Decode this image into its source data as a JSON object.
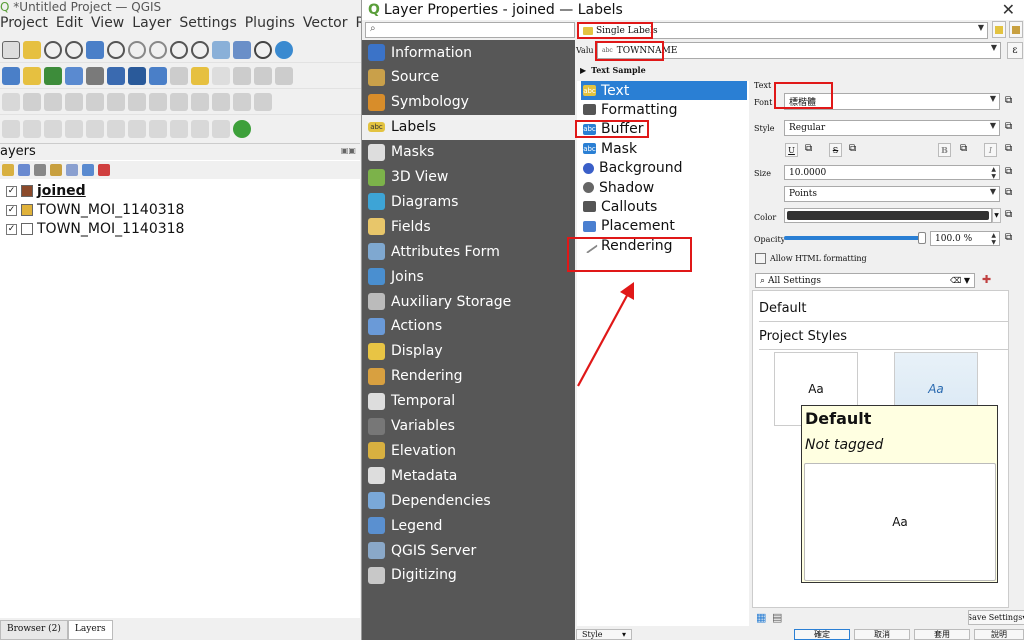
{
  "qgis": {
    "title": "*Untitled Project — QGIS",
    "menu": [
      "Project",
      "Edit",
      "View",
      "Layer",
      "Settings",
      "Plugins",
      "Vector",
      "Ra"
    ],
    "layers_panel": {
      "title": "ayers",
      "layers": [
        {
          "name": "joined",
          "color": "#8b4a2b",
          "checked": "✓",
          "bold": true
        },
        {
          "name": "TOWN_MOI_1140318",
          "color": "#e0b23a",
          "checked": "✓",
          "bold": false
        },
        {
          "name": "TOWN_MOI_1140318",
          "color": "#ffffff",
          "checked": "✓",
          "bold": false
        }
      ]
    },
    "bottom_tabs": [
      "Browser (2)",
      "Layers"
    ]
  },
  "dialog": {
    "title": "Layer Properties - joined — Labels",
    "nav": [
      {
        "label": "Information",
        "icon": "info-icon",
        "color": "#3b73c8"
      },
      {
        "label": "Source",
        "icon": "source-icon",
        "color": "#c9a04a"
      },
      {
        "label": "Symbology",
        "icon": "symbology-icon",
        "color": "#d88d2a"
      },
      {
        "label": "Labels",
        "icon": "labels-icon",
        "color": "#e3c340"
      },
      {
        "label": "Masks",
        "icon": "masks-icon",
        "color": "#dddddd"
      },
      {
        "label": "3D View",
        "icon": "3d-view-icon",
        "color": "#7cb24a"
      },
      {
        "label": "Diagrams",
        "icon": "diagrams-icon",
        "color": "#3da4d6"
      },
      {
        "label": "Fields",
        "icon": "fields-icon",
        "color": "#e8c66a"
      },
      {
        "label": "Attributes Form",
        "icon": "attributes-form-icon",
        "color": "#7fa8d0"
      },
      {
        "label": "Joins",
        "icon": "joins-icon",
        "color": "#4a8fd0"
      },
      {
        "label": "Auxiliary Storage",
        "icon": "auxiliary-storage-icon",
        "color": "#bbbbbb"
      },
      {
        "label": "Actions",
        "icon": "actions-icon",
        "color": "#6a9ad8"
      },
      {
        "label": "Display",
        "icon": "display-icon",
        "color": "#e8c444"
      },
      {
        "label": "Rendering",
        "icon": "rendering-icon",
        "color": "#d8a040"
      },
      {
        "label": "Temporal",
        "icon": "temporal-icon",
        "color": "#dddddd"
      },
      {
        "label": "Variables",
        "icon": "variables-icon",
        "color": "#777777"
      },
      {
        "label": "Elevation",
        "icon": "elevation-icon",
        "color": "#d8b040"
      },
      {
        "label": "Metadata",
        "icon": "metadata-icon",
        "color": "#dddddd"
      },
      {
        "label": "Dependencies",
        "icon": "dependencies-icon",
        "color": "#7aa8d8"
      },
      {
        "label": "Legend",
        "icon": "legend-icon",
        "color": "#5a90d0"
      },
      {
        "label": "QGIS Server",
        "icon": "qgis-server-icon",
        "color": "#8aa8c8"
      },
      {
        "label": "Digitizing",
        "icon": "digitizing-icon",
        "color": "#c8c8c8"
      }
    ],
    "selected_nav": "Labels",
    "mode_combo": "Single Labels",
    "value_label": "Valu",
    "value_field": "TOWNNAME",
    "text_sample_label": "Text Sample",
    "tabs": [
      {
        "label": "Text",
        "icon": "abc-text-icon"
      },
      {
        "label": "Formatting",
        "icon": "formatting-icon"
      },
      {
        "label": "Buffer",
        "icon": "buffer-icon"
      },
      {
        "label": "Mask",
        "icon": "mask-icon"
      },
      {
        "label": "Background",
        "icon": "background-icon"
      },
      {
        "label": "Shadow",
        "icon": "shadow-icon"
      },
      {
        "label": "Callouts",
        "icon": "callouts-icon"
      },
      {
        "label": "Placement",
        "icon": "placement-icon"
      },
      {
        "label": "Rendering",
        "icon": "rendering-brush-icon"
      }
    ],
    "text_props": {
      "section": "Text",
      "font_label": "Font",
      "font_value": "標楷體",
      "style_label": "Style",
      "style_value": "Regular",
      "size_label": "Size",
      "size_value": "10.0000",
      "unit_value": "Points",
      "color_label": "Color",
      "color_value": "#333333",
      "opacity_label": "Opacity",
      "opacity_value": "100.0 %",
      "opacity_fraction": 1.0,
      "html_label": "Allow HTML formatting",
      "style_buttons": [
        "U",
        "S",
        "B",
        "I"
      ]
    },
    "styles_search": "All Settings",
    "default_heading": "Default",
    "project_styles_heading": "Project Styles",
    "tile_sample": "Aa",
    "tooltip": {
      "title": "Default",
      "subtitle": "Not tagged",
      "sample": "Aa"
    },
    "save_settings": "Save Settings",
    "style_button": "Style",
    "footer_buttons": [
      "確定",
      "取消",
      "套用",
      "說明"
    ]
  }
}
